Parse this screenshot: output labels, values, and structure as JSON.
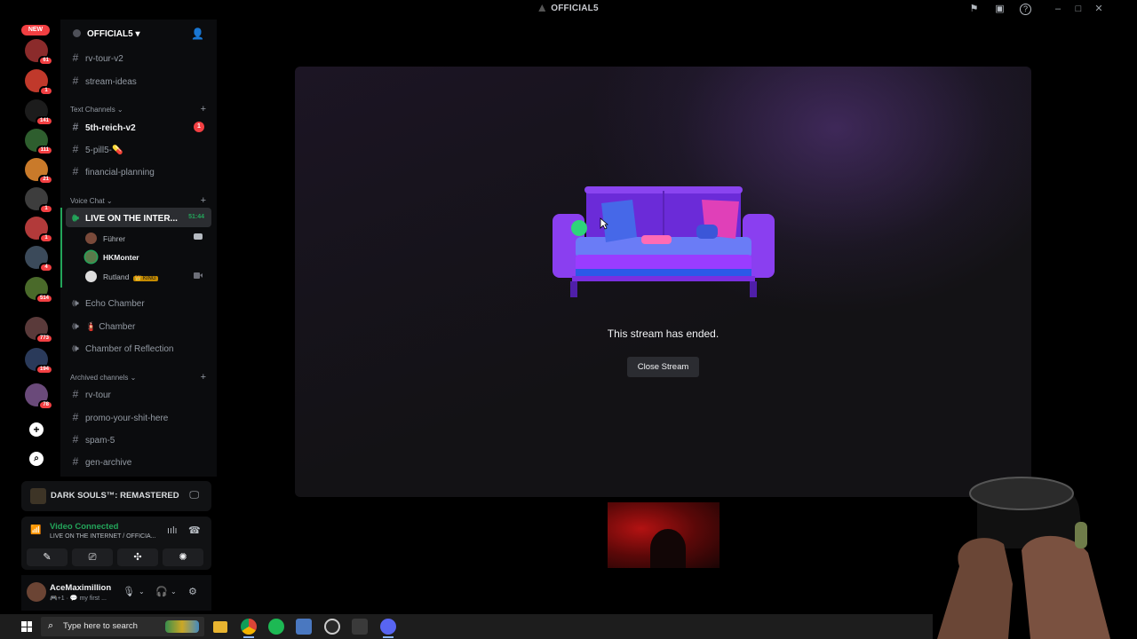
{
  "window": {
    "title": "OFFICIAL5"
  },
  "server_rail": {
    "new_badge": "NEW",
    "servers": [
      {
        "color": "#8b2b2b",
        "badge": "61"
      },
      {
        "color": "#c0392b",
        "badge": "1"
      },
      {
        "color": "#1c1c1c",
        "badge": "141"
      },
      {
        "color": "#2e5e2e",
        "badge": "111"
      },
      {
        "color": "#c97a2a",
        "badge": "21"
      },
      {
        "color": "#3d3d3d",
        "badge": "1"
      },
      {
        "color": "#b23a3a",
        "badge": "1"
      },
      {
        "color": "#3b4a5a",
        "badge": "4"
      },
      {
        "color": "#4a6a2a",
        "badge": "514"
      },
      {
        "color": "#5a3a3a",
        "badge": "773"
      },
      {
        "color": "#2a3a5a",
        "badge": "194"
      },
      {
        "color": "#6a4a7a",
        "badge": "78"
      }
    ]
  },
  "sidebar": {
    "server_name": "OFFICIAL5",
    "top_channels": [
      {
        "label": "rv-tour-v2"
      },
      {
        "label": "stream-ideas"
      }
    ],
    "categories": {
      "text": "Text Channels",
      "voice": "Voice Chat",
      "archived": "Archived channels"
    },
    "text_channels": [
      {
        "label": "5th-reich-v2",
        "badge": "1"
      },
      {
        "label": "5-pill5-💊"
      },
      {
        "label": "financial-planning"
      }
    ],
    "voice_active": {
      "label": "LIVE ON THE INTER...",
      "timer": "51:44"
    },
    "voice_users": [
      {
        "name": "Führer"
      },
      {
        "name": "HKMonter"
      },
      {
        "name": "Rutland",
        "tag": "👑 KING"
      }
    ],
    "voice_channels": [
      {
        "label": "Echo Chamber"
      },
      {
        "label": "🧯 Chamber"
      },
      {
        "label": "Chamber of Reflection"
      }
    ],
    "archived_channels": [
      {
        "label": "rv-tour"
      },
      {
        "label": "promo-your-shit-here"
      },
      {
        "label": "spam-5"
      },
      {
        "label": "gen-archive"
      }
    ]
  },
  "activity": {
    "game": "DARK SOULS™: REMASTERED"
  },
  "voice_panel": {
    "status": "Video Connected",
    "channel": "LIVE ON THE INTERNET / OFFICIA..."
  },
  "user": {
    "name": "AceMaximillion",
    "status": "my first ..."
  },
  "stream": {
    "message": "This stream has ended.",
    "close_label": "Close Stream"
  },
  "taskbar": {
    "search_placeholder": "Type here to search"
  }
}
